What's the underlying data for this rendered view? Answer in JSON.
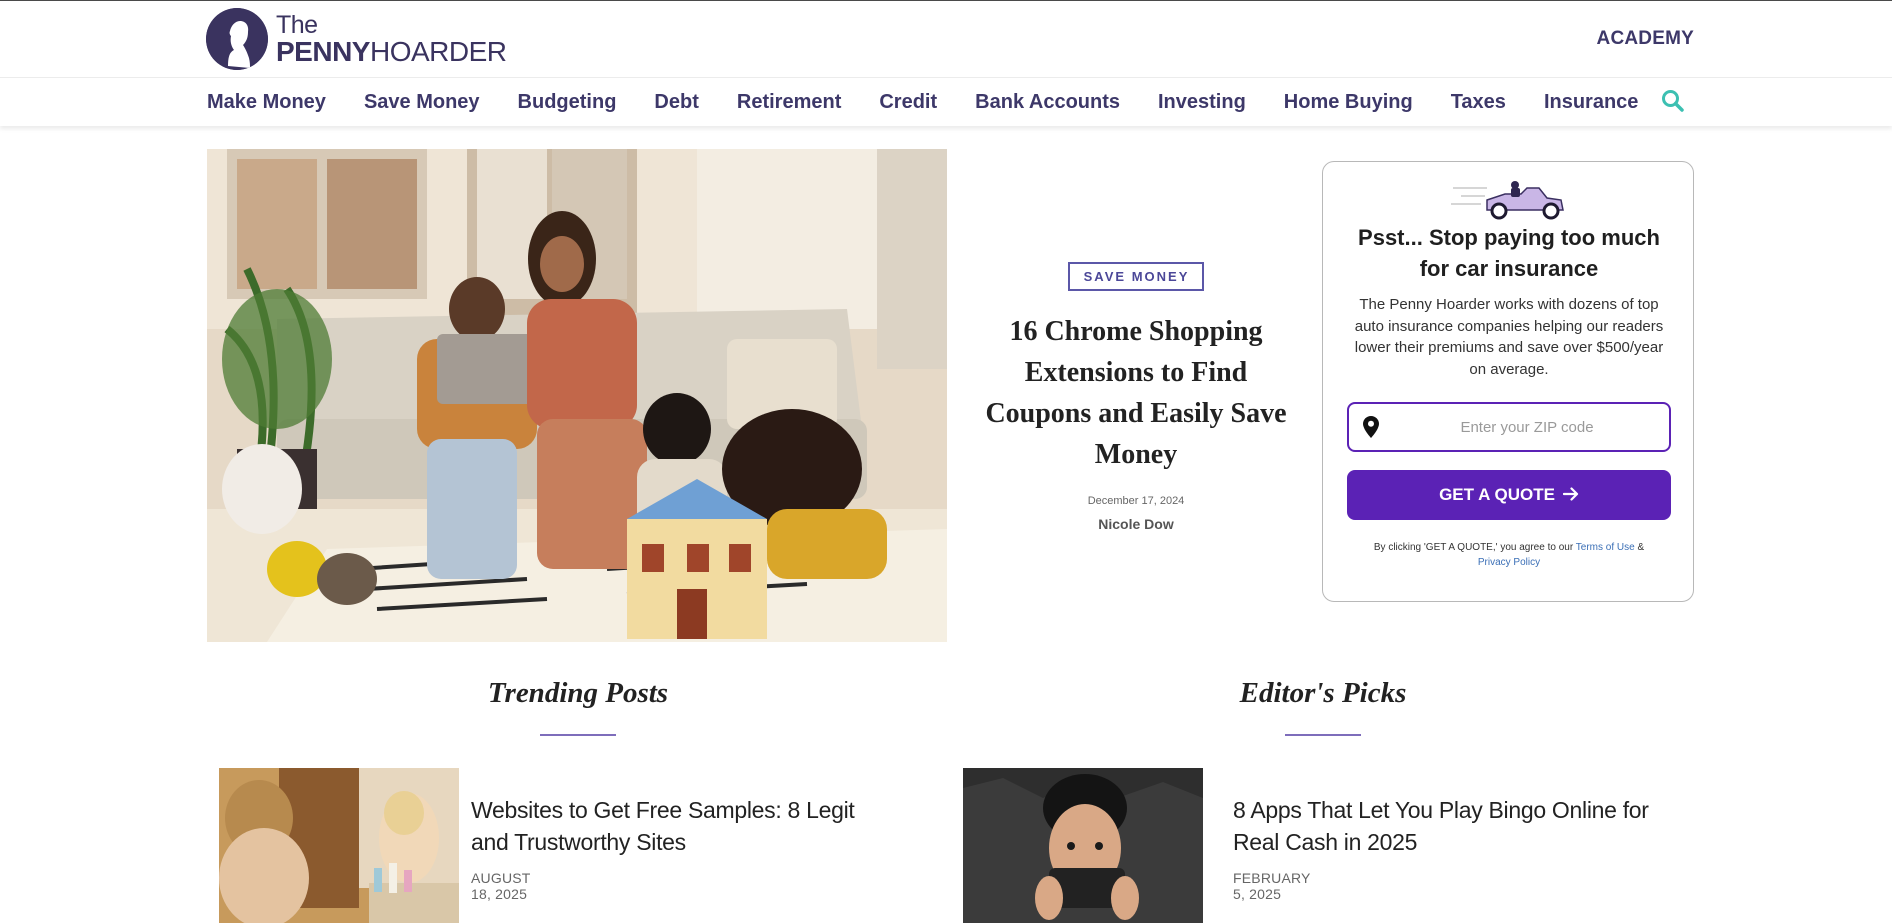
{
  "header": {
    "logo": {
      "the": "The",
      "penny": "PENNY",
      "hoarder": "HOARDER"
    },
    "academy_label": "ACADEMY"
  },
  "nav": {
    "items": [
      "Make Money",
      "Save Money",
      "Budgeting",
      "Debt",
      "Retirement",
      "Credit",
      "Bank Accounts",
      "Investing",
      "Home Buying",
      "Taxes",
      "Insurance"
    ],
    "search_icon": "search-icon",
    "search_icon_color": "#3cc0b2"
  },
  "hero": {
    "category": "SAVE MONEY",
    "title": "16 Chrome Shopping Extensions to Find Coupons and Easily Save Money",
    "date": "December 17, 2024",
    "author": "Nicole Dow"
  },
  "quote_card": {
    "title": "Psst... Stop paying too much for car insurance",
    "description": "The Penny Hoarder works with dozens of top auto insurance companies helping our readers lower their premiums and save over $500/year on average.",
    "zip_placeholder": "Enter your ZIP code",
    "zip_value": "",
    "button_label": "GET A QUOTE",
    "button_icon": "arrow-right-icon",
    "disclaimer_prefix": "By clicking 'GET A QUOTE,' you agree to our",
    "terms_link": "Terms of Use",
    "amp": "&",
    "privacy_link": "Privacy Policy",
    "accent_color": "#5b22b5"
  },
  "trending": {
    "heading": "Trending Posts",
    "post": {
      "title": "Websites to Get Free Samples: 8 Legit and Trustworthy Sites",
      "date": "AUGUST 18, 2025"
    }
  },
  "editors": {
    "heading": "Editor's Picks",
    "post": {
      "title": "8 Apps That Let You Play Bingo Online for Real Cash in 2025",
      "date": "FEBRUARY 5, 2025"
    }
  },
  "colors": {
    "brand": "#3d3869",
    "section_rule": "#7e6dbb",
    "category_border": "#5b57a8"
  }
}
